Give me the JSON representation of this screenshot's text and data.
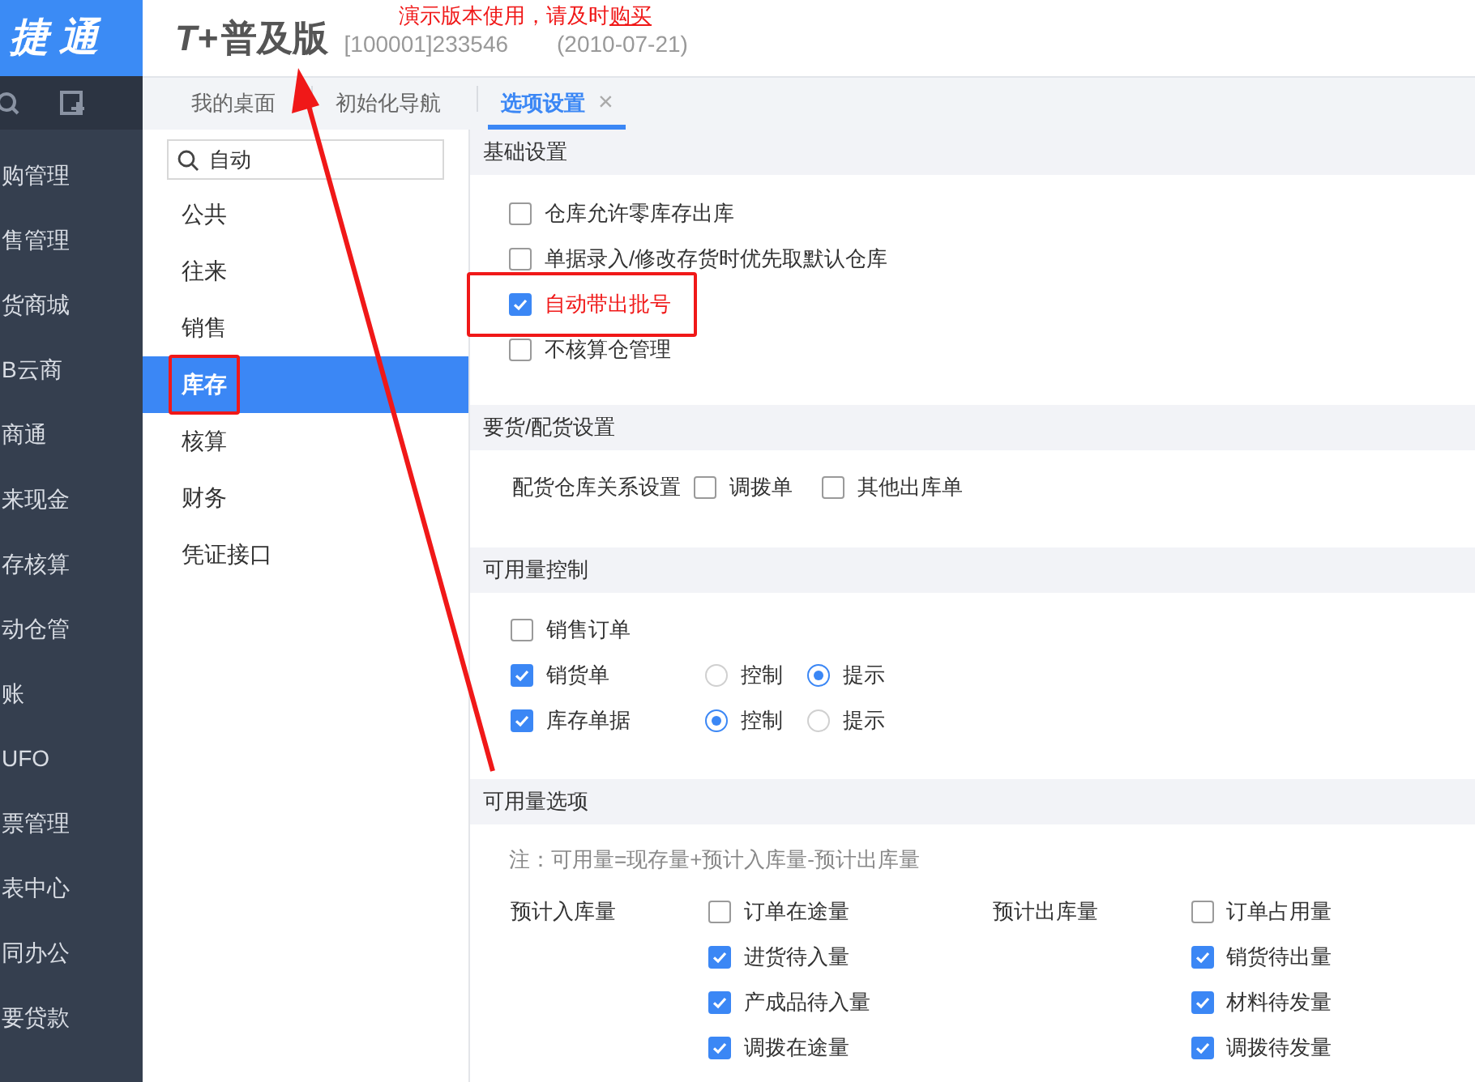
{
  "logo": {
    "text": "捷 通"
  },
  "product": {
    "brand": "T+",
    "edition": "普及版",
    "notice": "演示版本使用，请及时",
    "notice_link": "购买",
    "account": "[100001]233546",
    "date": "(2010-07-21)"
  },
  "nav": {
    "items": [
      {
        "label": "购管理"
      },
      {
        "label": "售管理"
      },
      {
        "label": "货商城"
      },
      {
        "label": "B云商"
      },
      {
        "label": "商通"
      },
      {
        "label": "来现金"
      },
      {
        "label": "存核算"
      },
      {
        "label": "动仓管"
      },
      {
        "label": "账"
      },
      {
        "label": "UFO"
      },
      {
        "label": "票管理"
      },
      {
        "label": "表中心"
      },
      {
        "label": "同办公"
      },
      {
        "label": "要贷款"
      }
    ]
  },
  "tabs": [
    {
      "label": "我的桌面",
      "selected": false
    },
    {
      "label": "初始化导航",
      "selected": false
    },
    {
      "label": "选项设置",
      "selected": true,
      "close": "×"
    }
  ],
  "search": {
    "value": "自动"
  },
  "categories": [
    {
      "label": "公共",
      "selected": false
    },
    {
      "label": "往来",
      "selected": false
    },
    {
      "label": "销售",
      "selected": false
    },
    {
      "label": "库存",
      "selected": true
    },
    {
      "label": "核算",
      "selected": false
    },
    {
      "label": "财务",
      "selected": false
    },
    {
      "label": "凭证接口",
      "selected": false
    }
  ],
  "sections": [
    {
      "title": "基础设置",
      "kind": "checklist",
      "items": [
        {
          "label": "仓库允许零库存出库",
          "checked": false,
          "highlighted": false
        },
        {
          "label": "单据录入/修改存货时优先取默认仓库",
          "checked": false,
          "highlighted": false
        },
        {
          "label": "自动带出批号",
          "checked": true,
          "highlighted": true
        },
        {
          "label": "不核算仓管理",
          "checked": false,
          "highlighted": false
        }
      ]
    },
    {
      "title": "要货/配货设置",
      "kind": "inline",
      "label": "配货仓库关系设置",
      "items": [
        {
          "label": "调拨单",
          "checked": false
        },
        {
          "label": "其他出库单",
          "checked": false
        }
      ]
    },
    {
      "title": "可用量控制",
      "kind": "control",
      "items": [
        {
          "label": "销售订单",
          "checked": false
        },
        {
          "label": "销货单",
          "checked": true,
          "options": [
            {
              "label": "控制",
              "selected": false
            },
            {
              "label": "提示",
              "selected": true
            }
          ]
        },
        {
          "label": "库存单据",
          "checked": true,
          "options": [
            {
              "label": "控制",
              "selected": true
            },
            {
              "label": "提示",
              "selected": false
            }
          ]
        }
      ]
    },
    {
      "title": "可用量选项",
      "kind": "columns",
      "note": "注：可用量=现存量+预计入库量-预计出库量",
      "columns": [
        {
          "label": "预计入库量",
          "items": [
            {
              "label": "订单在途量",
              "checked": false
            },
            {
              "label": "进货待入量",
              "checked": true
            },
            {
              "label": "产成品待入量",
              "checked": true
            },
            {
              "label": "调拨在途量",
              "checked": true
            }
          ]
        },
        {
          "label": "预计出库量",
          "items": [
            {
              "label": "订单占用量",
              "checked": false
            },
            {
              "label": "销货待出量",
              "checked": true
            },
            {
              "label": "材料待发量",
              "checked": true
            },
            {
              "label": "调拨待发量",
              "checked": true
            }
          ]
        }
      ]
    }
  ]
}
